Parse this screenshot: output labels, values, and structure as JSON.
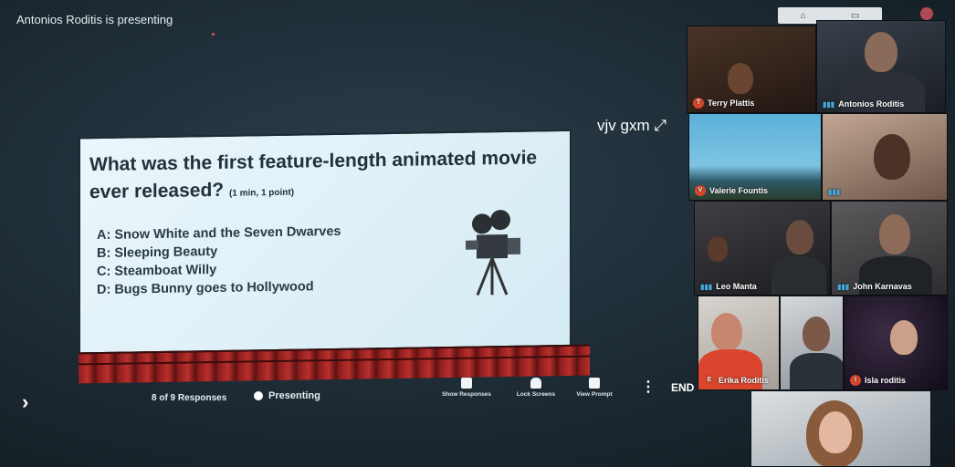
{
  "presenter_banner": "Antonios Roditis is presenting",
  "slide": {
    "question": "What was the first feature-length animated movie ever released?",
    "meta": "(1 min, 1 point)",
    "answers": [
      "A: Snow White and the Seven Dwarves",
      "B: Sleeping Beauty",
      "C: Steamboat Willy",
      "D: Bugs Bunny goes to Hollywood"
    ]
  },
  "controls": {
    "responses": "8 of 9 Responses",
    "status": "Presenting",
    "show_responses": "Show Responses",
    "lock_screens": "Lock Screens",
    "view_prompt": "View Prompt",
    "end": "END"
  },
  "handle": "vjv gxm",
  "participants": [
    {
      "name": "Terry Plattis",
      "initial": "T"
    },
    {
      "name": "Antonios Roditis",
      "initial": ""
    },
    {
      "name": "Valerie Fountis",
      "initial": "V"
    },
    {
      "name": "",
      "initial": ""
    },
    {
      "name": "Leo Manta",
      "initial": ""
    },
    {
      "name": "John Karnavas",
      "initial": ""
    },
    {
      "name": "Erika Roditis",
      "initial": "E"
    },
    {
      "name": "",
      "initial": ""
    },
    {
      "name": "Isla roditis",
      "initial": "I"
    },
    {
      "name": "",
      "initial": ""
    }
  ],
  "colors": {
    "accent_red": "#d7472b",
    "mic_blue": "#46a8d9"
  }
}
